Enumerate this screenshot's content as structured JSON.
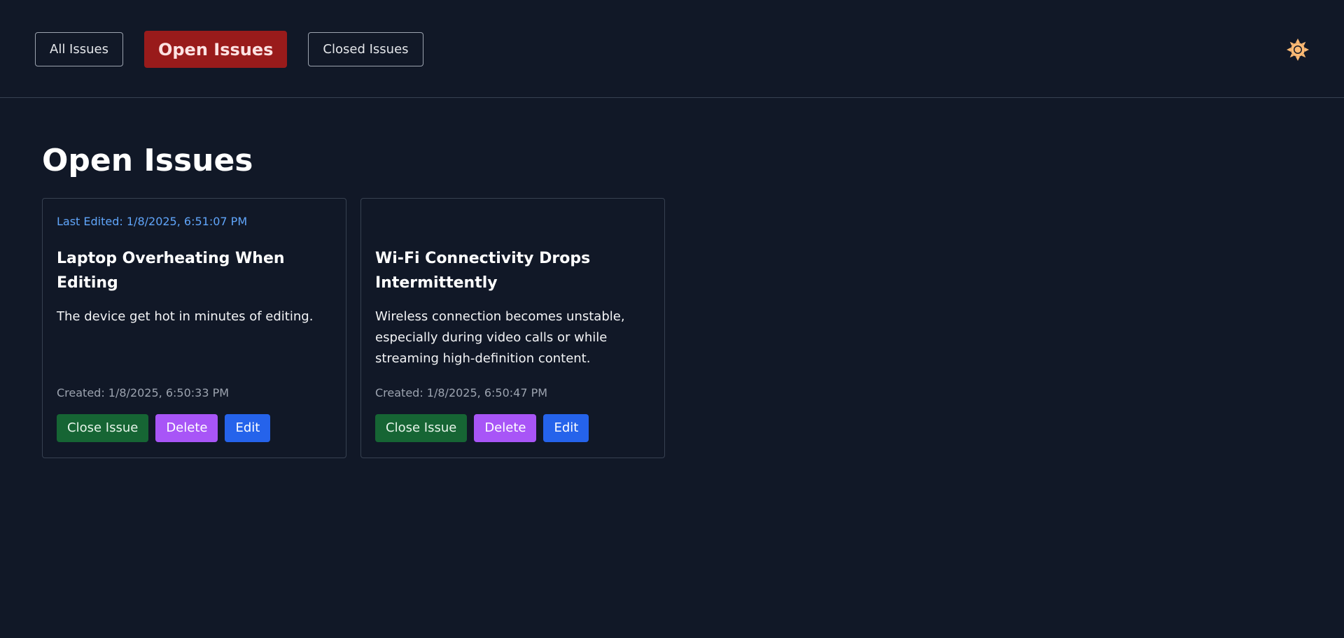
{
  "nav": {
    "all_label": "All Issues",
    "open_label": "Open Issues",
    "closed_label": "Closed Issues",
    "active": "open"
  },
  "theme_icon": "sun-icon",
  "main": {
    "title": "Open Issues"
  },
  "issues": [
    {
      "last_edited": "Last Edited: 1/8/2025, 6:51:07 PM",
      "title": "Laptop Overheating When Editing",
      "description": "The device get hot in minutes of editing.",
      "created": "Created: 1/8/2025, 6:50:33 PM",
      "close_label": "Close Issue",
      "delete_label": "Delete",
      "edit_label": "Edit"
    },
    {
      "last_edited": "",
      "title": "Wi-Fi Connectivity Drops Intermittently",
      "description": "Wireless connection becomes unstable, especially during video calls or while streaming high-definition content.",
      "created": "Created: 1/8/2025, 6:50:47 PM",
      "close_label": "Close Issue",
      "delete_label": "Delete",
      "edit_label": "Edit"
    }
  ],
  "colors": {
    "background": "#111827",
    "active_tab": "#991b1b",
    "close_button": "#166534",
    "delete_button": "#a855f7",
    "edit_button": "#2563eb",
    "edited_text": "#60a5fa",
    "sun_icon": "#fdba74"
  }
}
